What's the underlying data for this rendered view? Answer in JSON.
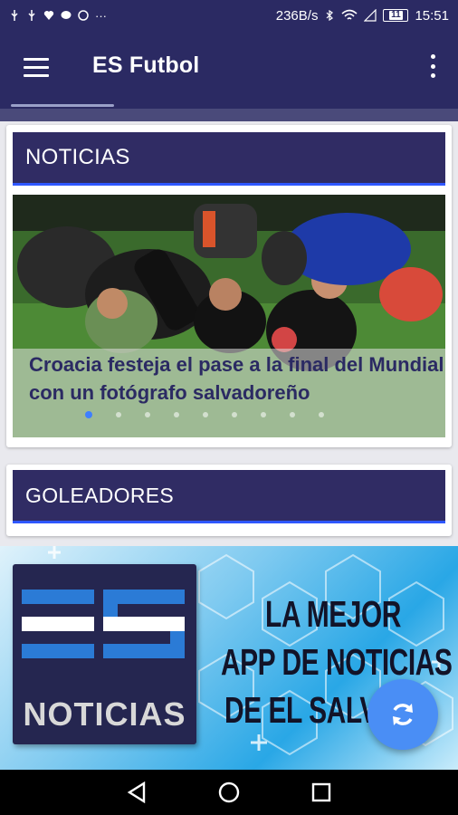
{
  "status_bar": {
    "network_speed": "236B/s",
    "battery": "11",
    "time": "15:51",
    "left_icons": [
      "usb-icon",
      "usb-icon",
      "heart-icon",
      "messenger-icon",
      "whatsapp-icon",
      "more-notifications-icon"
    ],
    "right_icons": [
      "bluetooth-icon",
      "wifi-icon",
      "signal-icon",
      "battery-icon"
    ]
  },
  "app_bar": {
    "title": "ES Futbol",
    "menu_icon": "hamburger-menu-icon",
    "overflow_icon": "more-vert-icon"
  },
  "news": {
    "header": "NOTICIAS",
    "slides": [
      {
        "caption": "Croacia festeja el pase a la final del Mundial con un fotógrafo salvadoreño"
      }
    ],
    "active_slide": 0,
    "slide_count": 9
  },
  "scorers": {
    "header": "GOLEADORES"
  },
  "banner": {
    "logo_letters": "ES",
    "logo_text": "NOTICIAS",
    "slogan_line1": "LA MEJOR",
    "slogan_line2": "APP DE NOTICIAS",
    "slogan_line3": "DE EL SALVA"
  },
  "fab": {
    "icon": "refresh-icon"
  },
  "nav_bar": {
    "back_icon": "back-icon",
    "home_icon": "home-icon",
    "recents_icon": "recents-icon"
  },
  "colors": {
    "primary": "#2b2a63",
    "accent": "#2f57ff",
    "fab": "#4a8ef5"
  }
}
